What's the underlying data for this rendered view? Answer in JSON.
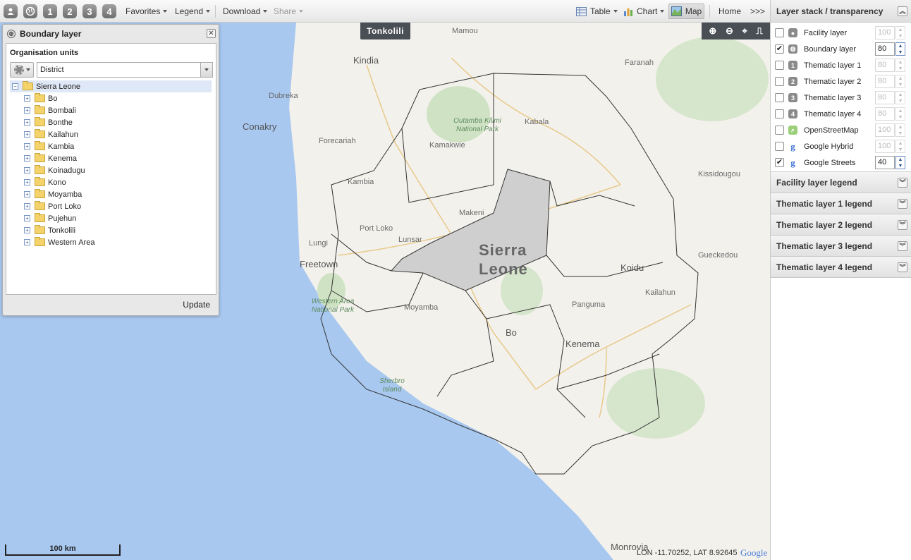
{
  "toolbar": {
    "numbered_layers": [
      "1",
      "2",
      "3",
      "4"
    ],
    "favorites": "Favorites",
    "legend": "Legend",
    "download": "Download",
    "share": "Share",
    "table": "Table",
    "chart": "Chart",
    "map": "Map",
    "home": "Home",
    "more": ">>>"
  },
  "map": {
    "hover_tooltip": "Tonkolili",
    "scale_label": "100 km",
    "coordinates": "LON -11.70252, LAT 8.92645",
    "attribution_logo": "Google",
    "country_label_line1": "Sierra",
    "country_label_line2": "Leone",
    "places": [
      "Mamou",
      "Kindia",
      "Faranah",
      "Dubreka",
      "Conakry",
      "Forecariah",
      "Kabala",
      "Kamakwie",
      "Kambia",
      "Makeni",
      "Port Loko",
      "Lunsar",
      "Lungi",
      "Freetown",
      "Koidu",
      "Moyamba",
      "Bo",
      "Panguma",
      "Kenema",
      "Kailahun",
      "Kissidougou",
      "Gueckedou",
      "Monrovia"
    ],
    "parks": [
      "Outamba Kilimi National Park",
      "Western Area National Park"
    ],
    "island": "Sherbro Island",
    "highlight_color": "#cfcfcf",
    "water_color": "#a8c8f0"
  },
  "boundary_window": {
    "title": "Boundary layer",
    "section_label": "Organisation units",
    "level_value": "District",
    "root": "Sierra Leone",
    "children": [
      "Bo",
      "Bombali",
      "Bonthe",
      "Kailahun",
      "Kambia",
      "Kenema",
      "Koinadugu",
      "Kono",
      "Moyamba",
      "Port Loko",
      "Pujehun",
      "Tonkolili",
      "Western Area"
    ],
    "update": "Update"
  },
  "right_panel": {
    "title": "Layer stack / transparency",
    "layers": [
      {
        "name": "Facility layer",
        "checked": false,
        "opacity": "100",
        "icon": "facility-icon"
      },
      {
        "name": "Boundary layer",
        "checked": true,
        "opacity": "80",
        "icon": "boundary-icon"
      },
      {
        "name": "Thematic layer 1",
        "checked": false,
        "opacity": "80",
        "icon": "thematic-1-icon"
      },
      {
        "name": "Thematic layer 2",
        "checked": false,
        "opacity": "80",
        "icon": "thematic-2-icon"
      },
      {
        "name": "Thematic layer 3",
        "checked": false,
        "opacity": "80",
        "icon": "thematic-3-icon"
      },
      {
        "name": "Thematic layer 4",
        "checked": false,
        "opacity": "80",
        "icon": "thematic-4-icon"
      },
      {
        "name": "OpenStreetMap",
        "checked": false,
        "opacity": "100",
        "icon": "osm-icon"
      },
      {
        "name": "Google Hybrid",
        "checked": false,
        "opacity": "100",
        "icon": "google-icon"
      },
      {
        "name": "Google Streets",
        "checked": true,
        "opacity": "40",
        "icon": "google-icon"
      }
    ],
    "legends": [
      "Facility layer legend",
      "Thematic layer 1 legend",
      "Thematic layer 2 legend",
      "Thematic layer 3 legend",
      "Thematic layer 4 legend"
    ]
  }
}
